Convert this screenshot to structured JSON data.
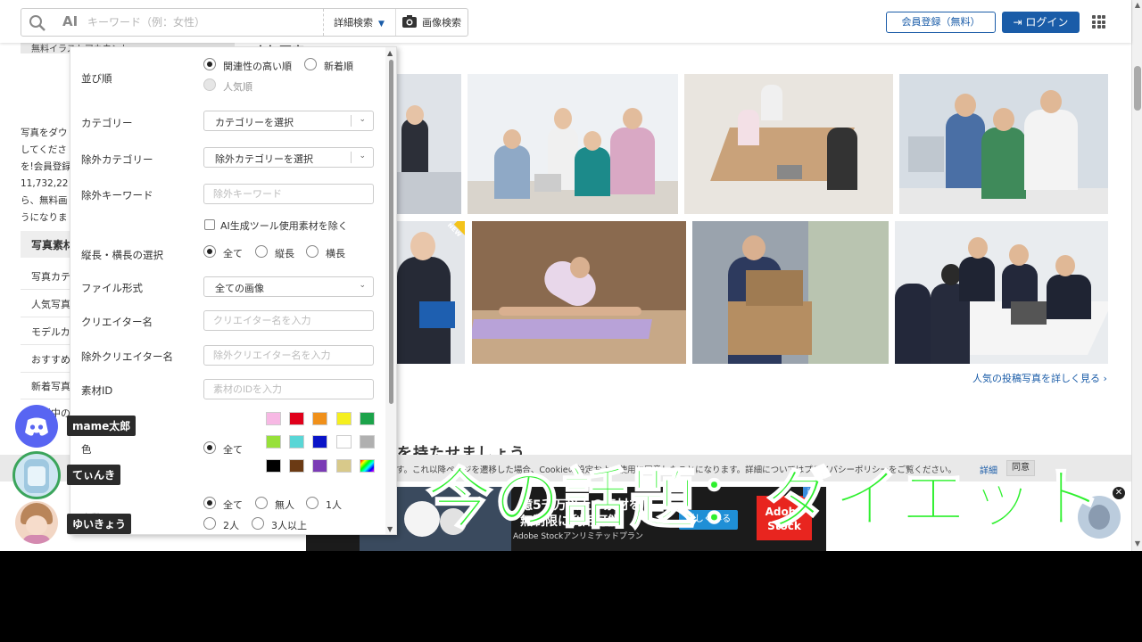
{
  "header": {
    "search_ai": "AI",
    "search_placeholder": "キーワード（例：女性）",
    "advanced_search": "詳細検索",
    "advanced_caret": "▼",
    "image_search": "画像検索",
    "register": "会員登録（無料）",
    "login": "ログイン"
  },
  "background": {
    "strip_tab": "無料イラストアカウント",
    "popular_tab": "人気写真",
    "intro_lines": [
      "写真をダウ",
      "してくださ",
      "を!会員登録",
      "11,732,22",
      "ら、無料画",
      "うになりま"
    ],
    "photo_section_header": "写真素材",
    "left_links": [
      "写真カテ",
      "人気写真",
      "モデルカ",
      "おすすめ",
      "新着写真",
      "撮影中の"
    ],
    "more_link": "人気の投稿写真を詳しく見る ›",
    "heading": "を持たせましょう",
    "new_badge": "NEW"
  },
  "cookie": {
    "text": "す。これ以降ページを遷移した場合、Cookieの設定および使用に同意したことになります。詳細についてはプライバシーポリシーをご覧ください。",
    "detail": "詳細",
    "agree": "同意"
  },
  "ad": {
    "line1": "億5千万以上の素材を",
    "line2": "無制限に利用可能",
    "line3": "Adobe Stockアンリミテッドプラン",
    "button": "詳しくみる",
    "logo_top": "Adobe",
    "logo_bottom": "Stock",
    "info": "i",
    "close": "✕"
  },
  "caption": "今の話題：ダイエット",
  "discord": {
    "users": [
      {
        "name": "mame太郎"
      },
      {
        "name": "てぃんき"
      },
      {
        "name": "ゆいきょう"
      }
    ]
  },
  "filter": {
    "sort": {
      "label": "並び順",
      "options": [
        "関連性の高い順",
        "新着順",
        "人気順"
      ],
      "selected": "関連性の高い順",
      "disabled": "人気順"
    },
    "category": {
      "label": "カテゴリー",
      "value": "カテゴリーを選択"
    },
    "exclude_category": {
      "label": "除外カテゴリー",
      "value": "除外カテゴリーを選択"
    },
    "exclude_keyword": {
      "label": "除外キーワード",
      "placeholder": "除外キーワード"
    },
    "ai_exclude": {
      "label": "AI生成ツール使用素材を除く",
      "checked": false
    },
    "orientation": {
      "label": "縦長・横長の選択",
      "options": [
        "全て",
        "縦長",
        "横長"
      ],
      "selected": "全て"
    },
    "file_format": {
      "label": "ファイル形式",
      "value": "全ての画像"
    },
    "creator": {
      "label": "クリエイター名",
      "placeholder": "クリエイター名を入力"
    },
    "exclude_creator": {
      "label": "除外クリエイター名",
      "placeholder": "除外クリエイター名を入力"
    },
    "material_id": {
      "label": "素材ID",
      "placeholder": "素材のIDを入力"
    },
    "color": {
      "label": "色",
      "all_label": "全て",
      "swatches": [
        "#f7b8e4",
        "#e0001b",
        "#f0901a",
        "#f5ef1e",
        "#1ca34a",
        "#97e03a",
        "#59d6d6",
        "#0a14c8",
        "#ffffff",
        "#b0b0b0",
        "#000000",
        "#6b3a14",
        "#7b3bb5",
        "#d8c98a",
        "rainbow"
      ]
    },
    "people": {
      "label": "人数",
      "options": [
        "全て",
        "無人",
        "1人",
        "2人",
        "3人以上"
      ],
      "selected": "全て"
    }
  }
}
